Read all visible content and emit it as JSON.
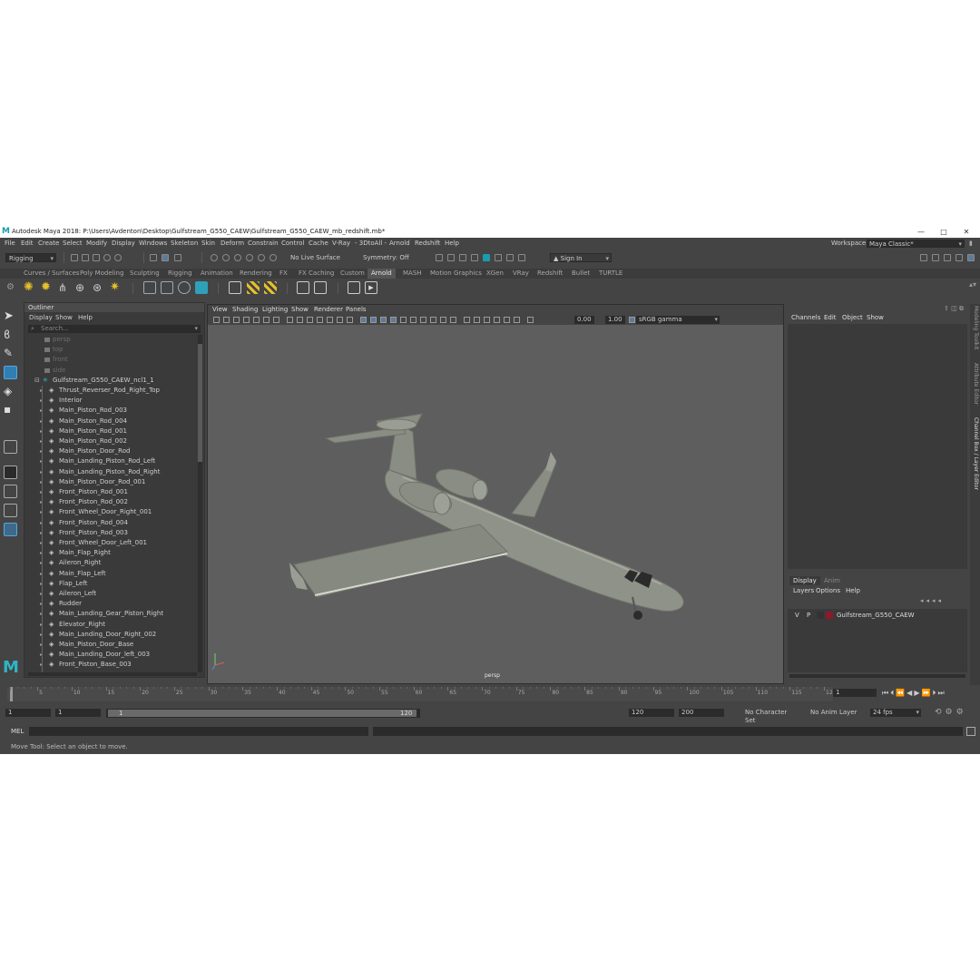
{
  "title": "Autodesk Maya 2018: P:\\Users\\Avdenton\\Desktop\\Gulfstream_G550_CAEW\\Gulfstream_G550_CAEW_mb_redshift.mb*",
  "window_buttons": [
    "—",
    "□",
    "✕"
  ],
  "menu": [
    "File",
    "Edit",
    "Create",
    "Select",
    "Modify",
    "Display",
    "Windows",
    "Skeleton",
    "Skin",
    "Deform",
    "Constrain",
    "Control",
    "Cache",
    "V-Ray",
    "- 3DtoAll -",
    "Arnold",
    "Redshift",
    "Help"
  ],
  "workspace": {
    "label": "Workspace :",
    "value": "Maya Classic*"
  },
  "status_line": {
    "mode": "Rigging",
    "live_surface": "No Live Surface",
    "symmetry": "Symmetry: Off",
    "sign_in": "Sign In"
  },
  "shelf_tabs": [
    "Curves / Surfaces",
    "Poly Modeling",
    "Sculpting",
    "Rigging",
    "Animation",
    "Rendering",
    "FX",
    "FX Caching",
    "Custom",
    "Arnold",
    "MASH",
    "Motion Graphics",
    "XGen",
    "VRay",
    "Redshift",
    "Bullet",
    "TURTLE"
  ],
  "active_shelf": "Arnold",
  "outliner": {
    "title": "Outliner",
    "menu": [
      "Display",
      "Show",
      "Help"
    ],
    "search_placeholder": "Search...",
    "cameras": [
      "persp",
      "top",
      "front",
      "side"
    ],
    "root": "Gulfstream_G550_CAEW_ncl1_1",
    "items": [
      "Thrust_Reverser_Rod_Right_Top",
      "Interior",
      "Main_Piston_Rod_003",
      "Main_Piston_Rod_004",
      "Main_Piston_Rod_001",
      "Main_Piston_Rod_002",
      "Main_Piston_Door_Rod",
      "Main_Landing_Piston_Rod_Left",
      "Main_Landing_Piston_Rod_Right",
      "Main_Piston_Door_Rod_001",
      "Front_Piston_Rod_001",
      "Front_Piston_Rod_002",
      "Front_Wheel_Door_Right_001",
      "Front_Piston_Rod_004",
      "Front_Piston_Rod_003",
      "Front_Wheel_Door_Left_001",
      "Main_Flap_Right",
      "Aileron_Right",
      "Main_Flap_Left",
      "Flap_Left",
      "Aileron_Left",
      "Rudder",
      "Main_Landing_Gear_Piston_Right",
      "Elevator_Right",
      "Main_Landing_Door_Right_002",
      "Main_Piston_Door_Base",
      "Main_Landing_Door_left_003",
      "Front_Piston_Base_003"
    ]
  },
  "viewport": {
    "menu": [
      "View",
      "Shading",
      "Lighting",
      "Show",
      "Renderer",
      "Panels"
    ],
    "exposure": "0.00",
    "gamma": "1.00",
    "color_space": "sRGB gamma",
    "camera_label": "persp"
  },
  "channel_box": {
    "menu": [
      "Channels",
      "Edit",
      "Object",
      "Show"
    ]
  },
  "layer_editor": {
    "tabs": [
      "Display",
      "Anim"
    ],
    "menu": [
      "Layers",
      "Options",
      "Help"
    ],
    "layer": {
      "v": "V",
      "p": "P",
      "name": "Gulfstream_G550_CAEW",
      "color": "#8b1a2b"
    }
  },
  "side_tabs": [
    "Modeling Toolkit",
    "Attribute Editor",
    "Channel Box / Layer Editor"
  ],
  "timeline": {
    "ticks": [
      "1",
      "5",
      "10",
      "15",
      "20",
      "25",
      "30",
      "35",
      "40",
      "45",
      "50",
      "55",
      "60",
      "65",
      "70",
      "75",
      "80",
      "85",
      "90",
      "95",
      "100",
      "105",
      "110",
      "115",
      "120"
    ],
    "current_frame": "1"
  },
  "range": {
    "start": "1",
    "playback_start": "1",
    "slider_start": "1",
    "slider_end": "120",
    "playback_end": "120",
    "end": "200",
    "character_set": "No Character Set",
    "anim_layer": "No Anim Layer",
    "fps": "24 fps"
  },
  "mel": {
    "label": "MEL"
  },
  "help_line": "Move Tool: Select an object to move.",
  "colors": {
    "accent": "#1a9bb0",
    "viewport_bg": "#5e5e5e",
    "panel_bg": "#444444"
  }
}
